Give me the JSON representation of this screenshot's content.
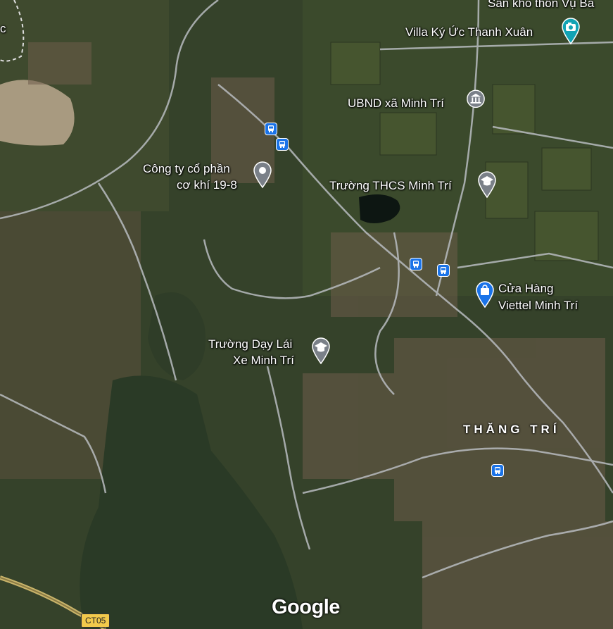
{
  "places": {
    "top_partial": "Sân kho thôn Vụ Ba",
    "villa": "Villa Ký Ức Thanh Xuân",
    "ubnd": "UBND xã Minh Trí",
    "company_line1": "Công ty cổ phần",
    "company_line2": "cơ khí 19-8",
    "school": "Trường THCS Minh Trí",
    "store_line1": "Cửa Hàng",
    "store_line2": "Viettel Minh Trí",
    "driving_line1": "Trường Dạy Lái",
    "driving_line2": "Xe Minh Trí",
    "left_partial": "c"
  },
  "area_label": "THĂNG TRÍ",
  "road_shield": "CT05",
  "attribution": "Google",
  "colors": {
    "pin_blue": "#1a73e8",
    "pin_gray": "#7a8088",
    "pin_teal": "#12a3b4",
    "road": "#b8bcc0"
  },
  "icons": [
    "camera-icon",
    "government-icon",
    "location-pin-icon",
    "school-icon",
    "shopping-bag-icon",
    "bus-stop-icon"
  ]
}
